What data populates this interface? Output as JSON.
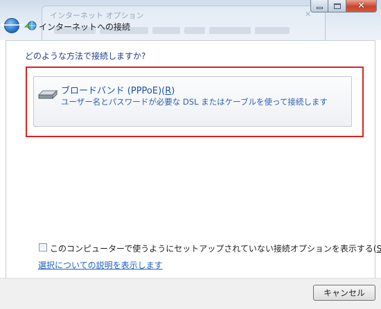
{
  "window": {
    "title": "インターネットへの接続",
    "background_window_title": "インターネット オプション",
    "accent_color": "#1f4fa8",
    "highlight_color": "#e0201b"
  },
  "icons": {
    "back": "back-arrow-icon",
    "network": "network-globe-icon",
    "modem": "broadband-modem-icon"
  },
  "content": {
    "question": "どのような方法で接続しますか?",
    "options": [
      {
        "title_text": "ブロードバンド (PPPoE)(",
        "mnemonic": "R",
        "title_close": ")",
        "description": "ユーザー名とパスワードが必要な DSL またはケーブルを使って接続します"
      }
    ],
    "show_unconfigured_label": "このコンピューターで使うようにセットアップされていない接続オプションを表示する(",
    "show_unconfigured_mnemonic": "S",
    "show_unconfigured_close": ")",
    "show_unconfigured_checked": false,
    "help_link": "選択についての説明を表示します"
  },
  "footer": {
    "cancel_label": "キャンセル"
  }
}
